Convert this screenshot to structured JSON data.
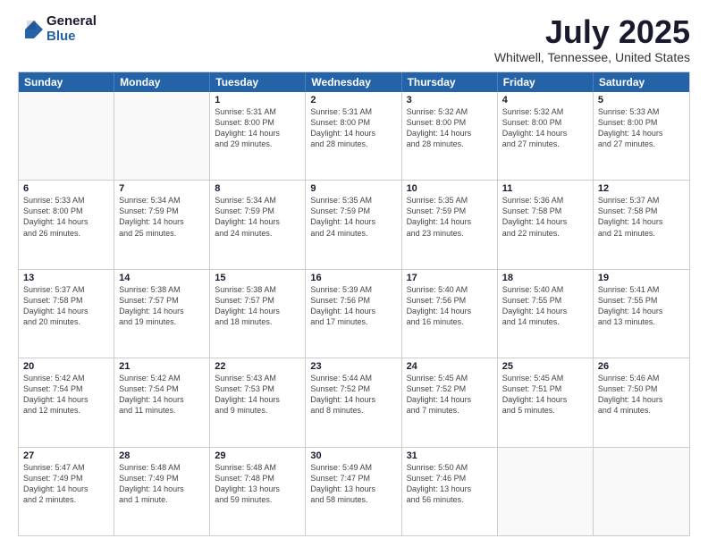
{
  "logo": {
    "general": "General",
    "blue": "Blue"
  },
  "title": "July 2025",
  "location": "Whitwell, Tennessee, United States",
  "header_days": [
    "Sunday",
    "Monday",
    "Tuesday",
    "Wednesday",
    "Thursday",
    "Friday",
    "Saturday"
  ],
  "weeks": [
    [
      {
        "day": "",
        "info": ""
      },
      {
        "day": "",
        "info": ""
      },
      {
        "day": "1",
        "info": "Sunrise: 5:31 AM\nSunset: 8:00 PM\nDaylight: 14 hours\nand 29 minutes."
      },
      {
        "day": "2",
        "info": "Sunrise: 5:31 AM\nSunset: 8:00 PM\nDaylight: 14 hours\nand 28 minutes."
      },
      {
        "day": "3",
        "info": "Sunrise: 5:32 AM\nSunset: 8:00 PM\nDaylight: 14 hours\nand 28 minutes."
      },
      {
        "day": "4",
        "info": "Sunrise: 5:32 AM\nSunset: 8:00 PM\nDaylight: 14 hours\nand 27 minutes."
      },
      {
        "day": "5",
        "info": "Sunrise: 5:33 AM\nSunset: 8:00 PM\nDaylight: 14 hours\nand 27 minutes."
      }
    ],
    [
      {
        "day": "6",
        "info": "Sunrise: 5:33 AM\nSunset: 8:00 PM\nDaylight: 14 hours\nand 26 minutes."
      },
      {
        "day": "7",
        "info": "Sunrise: 5:34 AM\nSunset: 7:59 PM\nDaylight: 14 hours\nand 25 minutes."
      },
      {
        "day": "8",
        "info": "Sunrise: 5:34 AM\nSunset: 7:59 PM\nDaylight: 14 hours\nand 24 minutes."
      },
      {
        "day": "9",
        "info": "Sunrise: 5:35 AM\nSunset: 7:59 PM\nDaylight: 14 hours\nand 24 minutes."
      },
      {
        "day": "10",
        "info": "Sunrise: 5:35 AM\nSunset: 7:59 PM\nDaylight: 14 hours\nand 23 minutes."
      },
      {
        "day": "11",
        "info": "Sunrise: 5:36 AM\nSunset: 7:58 PM\nDaylight: 14 hours\nand 22 minutes."
      },
      {
        "day": "12",
        "info": "Sunrise: 5:37 AM\nSunset: 7:58 PM\nDaylight: 14 hours\nand 21 minutes."
      }
    ],
    [
      {
        "day": "13",
        "info": "Sunrise: 5:37 AM\nSunset: 7:58 PM\nDaylight: 14 hours\nand 20 minutes."
      },
      {
        "day": "14",
        "info": "Sunrise: 5:38 AM\nSunset: 7:57 PM\nDaylight: 14 hours\nand 19 minutes."
      },
      {
        "day": "15",
        "info": "Sunrise: 5:38 AM\nSunset: 7:57 PM\nDaylight: 14 hours\nand 18 minutes."
      },
      {
        "day": "16",
        "info": "Sunrise: 5:39 AM\nSunset: 7:56 PM\nDaylight: 14 hours\nand 17 minutes."
      },
      {
        "day": "17",
        "info": "Sunrise: 5:40 AM\nSunset: 7:56 PM\nDaylight: 14 hours\nand 16 minutes."
      },
      {
        "day": "18",
        "info": "Sunrise: 5:40 AM\nSunset: 7:55 PM\nDaylight: 14 hours\nand 14 minutes."
      },
      {
        "day": "19",
        "info": "Sunrise: 5:41 AM\nSunset: 7:55 PM\nDaylight: 14 hours\nand 13 minutes."
      }
    ],
    [
      {
        "day": "20",
        "info": "Sunrise: 5:42 AM\nSunset: 7:54 PM\nDaylight: 14 hours\nand 12 minutes."
      },
      {
        "day": "21",
        "info": "Sunrise: 5:42 AM\nSunset: 7:54 PM\nDaylight: 14 hours\nand 11 minutes."
      },
      {
        "day": "22",
        "info": "Sunrise: 5:43 AM\nSunset: 7:53 PM\nDaylight: 14 hours\nand 9 minutes."
      },
      {
        "day": "23",
        "info": "Sunrise: 5:44 AM\nSunset: 7:52 PM\nDaylight: 14 hours\nand 8 minutes."
      },
      {
        "day": "24",
        "info": "Sunrise: 5:45 AM\nSunset: 7:52 PM\nDaylight: 14 hours\nand 7 minutes."
      },
      {
        "day": "25",
        "info": "Sunrise: 5:45 AM\nSunset: 7:51 PM\nDaylight: 14 hours\nand 5 minutes."
      },
      {
        "day": "26",
        "info": "Sunrise: 5:46 AM\nSunset: 7:50 PM\nDaylight: 14 hours\nand 4 minutes."
      }
    ],
    [
      {
        "day": "27",
        "info": "Sunrise: 5:47 AM\nSunset: 7:49 PM\nDaylight: 14 hours\nand 2 minutes."
      },
      {
        "day": "28",
        "info": "Sunrise: 5:48 AM\nSunset: 7:49 PM\nDaylight: 14 hours\nand 1 minute."
      },
      {
        "day": "29",
        "info": "Sunrise: 5:48 AM\nSunset: 7:48 PM\nDaylight: 13 hours\nand 59 minutes."
      },
      {
        "day": "30",
        "info": "Sunrise: 5:49 AM\nSunset: 7:47 PM\nDaylight: 13 hours\nand 58 minutes."
      },
      {
        "day": "31",
        "info": "Sunrise: 5:50 AM\nSunset: 7:46 PM\nDaylight: 13 hours\nand 56 minutes."
      },
      {
        "day": "",
        "info": ""
      },
      {
        "day": "",
        "info": ""
      }
    ]
  ]
}
